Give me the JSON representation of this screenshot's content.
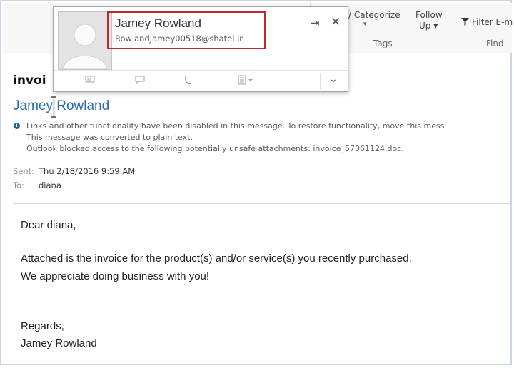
{
  "ribbon": {
    "categorize_label": "/ Categorize",
    "follow_label": "Follow",
    "followup_label": "Up ▾",
    "filter_label": "Filter E-m",
    "tags_group": "Tags",
    "find_group": "Find"
  },
  "contact_card": {
    "name": "Jamey Rowland",
    "email": "RowlandJamey00518@shatel.ir",
    "pin_icon": "pin-icon",
    "close_icon": "close-icon"
  },
  "message": {
    "subject": "invoi",
    "sender": "Jamey Rowland",
    "info_lines": [
      "Links and other functionality have been disabled in this message. To restore functionality, move this mess",
      "This message was converted to plain text.",
      "Outlook blocked access to the following potentially unsafe attachments: invoice_57061124.doc."
    ],
    "sent_label": "Sent:",
    "sent_value": "Thu 2/18/2016 9:59 AM",
    "to_label": "To:",
    "to_value": "diana"
  },
  "body": {
    "greeting": "Dear diana,",
    "line1": "Attached is the invoice for the product(s) and/or service(s) you recently purchased.",
    "line2": "We appreciate doing business with you!",
    "closing": "Regards,",
    "signature": "Jamey Rowland"
  }
}
